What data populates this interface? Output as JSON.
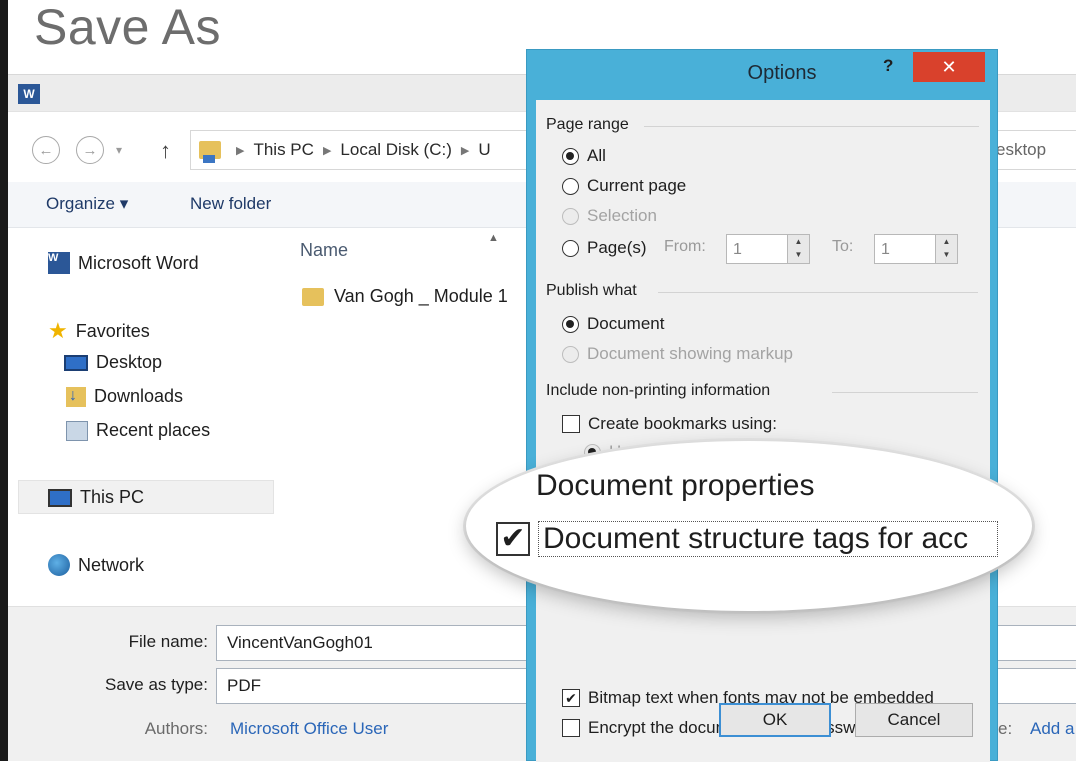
{
  "window": {
    "title": "Save As"
  },
  "nav": {
    "back_icon": "back-arrow-icon",
    "forward_icon": "forward-arrow-icon",
    "breadcrumbs": [
      "This PC",
      "Local Disk (C:)",
      "U"
    ],
    "search_partial": "esktop"
  },
  "toolbar": {
    "organize": "Organize ▾",
    "new_folder": "New folder"
  },
  "sidebar": {
    "word": "Microsoft Word",
    "favorites": "Favorites",
    "desktop": "Desktop",
    "downloads": "Downloads",
    "recent": "Recent places",
    "this_pc": "This PC",
    "network": "Network"
  },
  "files": {
    "column_name": "Name",
    "items": [
      "Van Gogh _ Module 1"
    ]
  },
  "bottom": {
    "file_name_label": "File name:",
    "file_name_value": "VincentVanGogh01",
    "save_type_label": "Save as type:",
    "save_type_value": "PDF",
    "authors_label": "Authors:",
    "authors_value": "Microsoft Office User",
    "tags_label_partial": "e:",
    "tags_value_partial": "Add a"
  },
  "options": {
    "title": "Options",
    "help": "?",
    "close": "✕",
    "page_range": "Page range",
    "all": "All",
    "current_page": "Current page",
    "selection": "Selection",
    "pages": "Page(s)",
    "from_label": "From:",
    "from_value": "1",
    "to_label": "To:",
    "to_value": "1",
    "publish_what": "Publish what",
    "document": "Document",
    "doc_markup": "Document showing markup",
    "include_nonprint": "Include non-printing information",
    "create_bookmarks": "Create bookmarks using:",
    "headings": "Headings",
    "bitmap_text": "Bitmap text when fonts may not be embedded",
    "encrypt": "Encrypt the document with a password",
    "ok": "OK",
    "cancel": "Cancel"
  },
  "magnifier": {
    "doc_properties": "Document properties",
    "doc_structure": "Document structure tags for acc"
  }
}
